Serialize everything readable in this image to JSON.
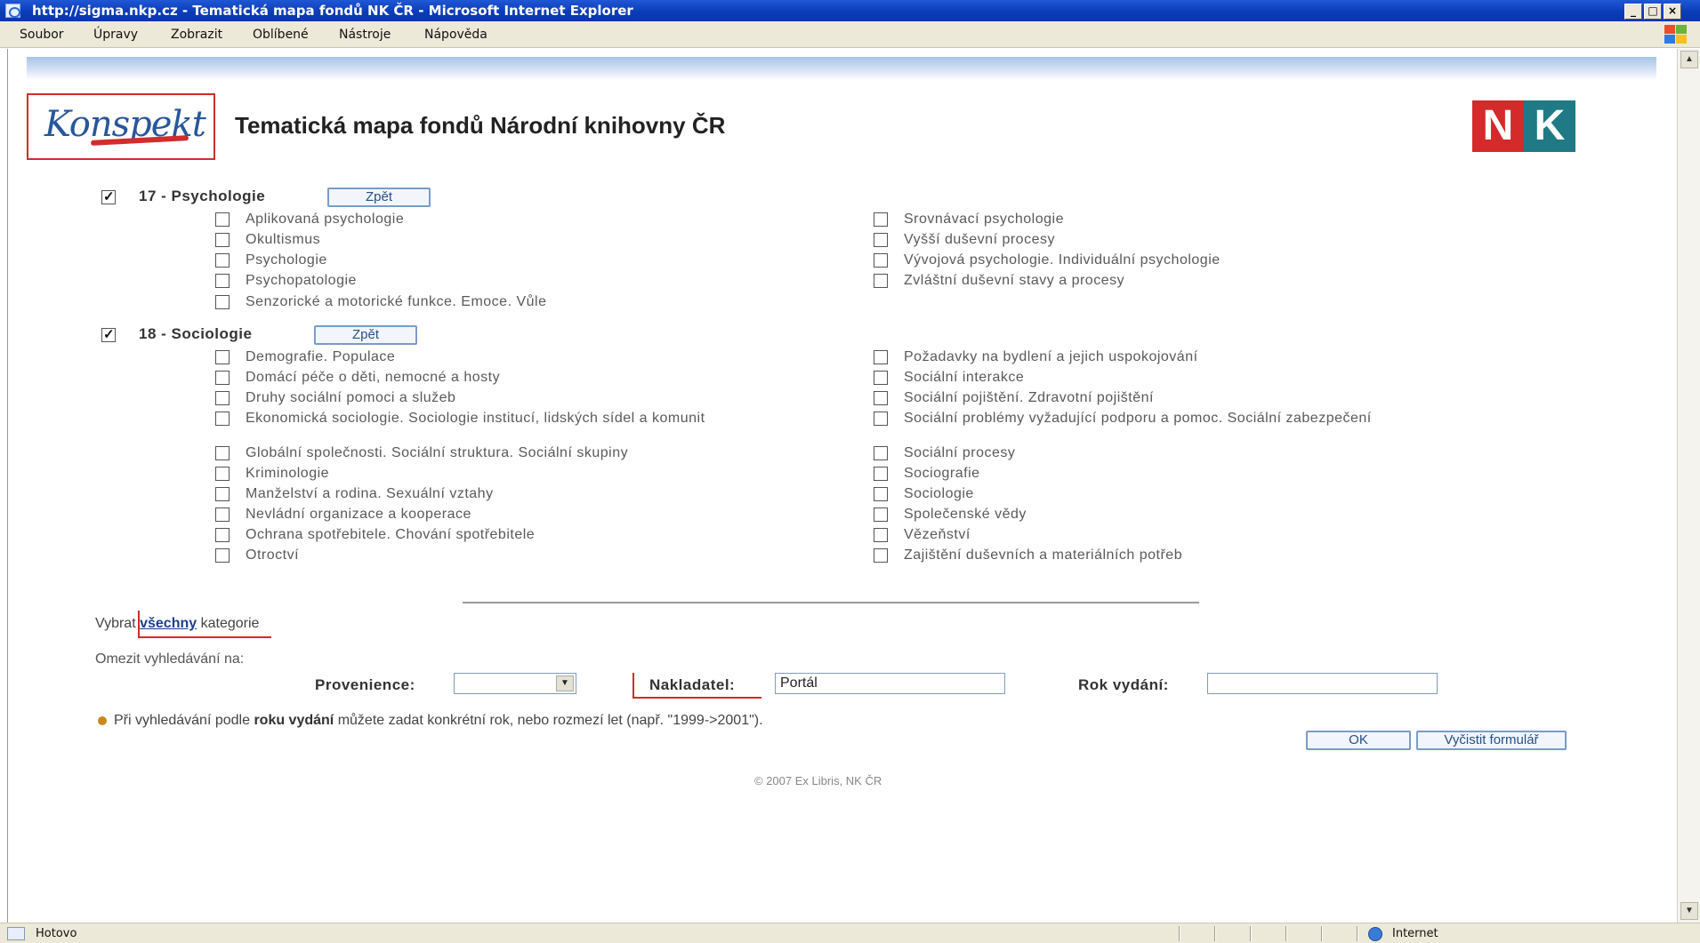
{
  "window": {
    "title": "http://sigma.nkp.cz - Tematická mapa fondů NK ČR - Microsoft Internet Explorer",
    "controls": [
      "_",
      "□",
      "×"
    ]
  },
  "menu": [
    "Soubor",
    "Úpravy",
    "Zobrazit",
    "Oblíbené",
    "Nástroje",
    "Nápověda"
  ],
  "header": {
    "logo_text": "Konspekt",
    "title": "Tematická mapa fondů Národní knihovny ČR",
    "nk_logo": [
      "N",
      "K"
    ]
  },
  "categories": [
    {
      "number": "17",
      "heading": "17 - Psychologie",
      "checked": true,
      "back_label": "Zpět",
      "left_items": [
        "Aplikovaná psychologie",
        "Okultismus",
        "Psychologie",
        "Psychopatologie",
        "Senzorické a motorické funkce. Emoce. Vůle"
      ],
      "right_items": [
        "Srovnávací psychologie",
        "Vyšší duševní procesy",
        "Vývojová psychologie. Individuální psychologie",
        "Zvláštní duševní stavy a procesy"
      ]
    },
    {
      "number": "18",
      "heading": "18 - Sociologie",
      "checked": true,
      "back_label": "Zpět",
      "left_items": [
        "Demografie. Populace",
        "Domácí péče o děti, nemocné a hosty",
        "Druhy sociální pomoci a služeb",
        "Ekonomická sociologie. Sociologie institucí, lidských sídel a komunit",
        "Globální společnosti. Sociální struktura. Sociální skupiny",
        "Kriminologie",
        "Manželství a rodina. Sexuální vztahy",
        "Nevládní organizace a kooperace",
        "Ochrana spotřebitele. Chování spotřebitele",
        "Otroctví"
      ],
      "right_items": [
        "Požadavky na bydlení a jejich uspokojování",
        "Sociální interakce",
        "Sociální pojištění. Zdravotní pojištění",
        "Sociální problémy vyžadující podporu a pomoc. Sociální zabezpečení",
        "Sociální procesy",
        "Sociografie",
        "Sociologie",
        "Společenské vědy",
        "Vězeňství",
        "Zajištění duševních a materiálních potřeb"
      ]
    }
  ],
  "select_all": {
    "prefix": "Vybrat",
    "link": "všechny",
    "suffix": "kategorie"
  },
  "restrict_label": "Omezit vyhledávání na:",
  "form": {
    "provenience_label": "Provenience:",
    "provenience_value": "",
    "publisher_label": "Nakladatel:",
    "publisher_value": "Portál",
    "year_label": "Rok vydání:",
    "year_value": ""
  },
  "hint": {
    "prefix": "Při vyhledávání podle",
    "bold": "roku vydání",
    "suffix": "můžete zadat konkrétní rok, nebo rozmezí let (např. \"1999->2001\")."
  },
  "buttons": {
    "ok": "OK",
    "clear": "Vyčistit formulář"
  },
  "copyright": "© 2007 Ex Libris, NK ČR",
  "status": {
    "text": "Hotovo",
    "zone": "Internet"
  },
  "colors": {
    "titlebar": "#0b3cb8",
    "accent_red": "#d22c2c",
    "link": "#1b3e8e",
    "nk_red": "#d42a2a",
    "nk_teal": "#1f7a86"
  }
}
